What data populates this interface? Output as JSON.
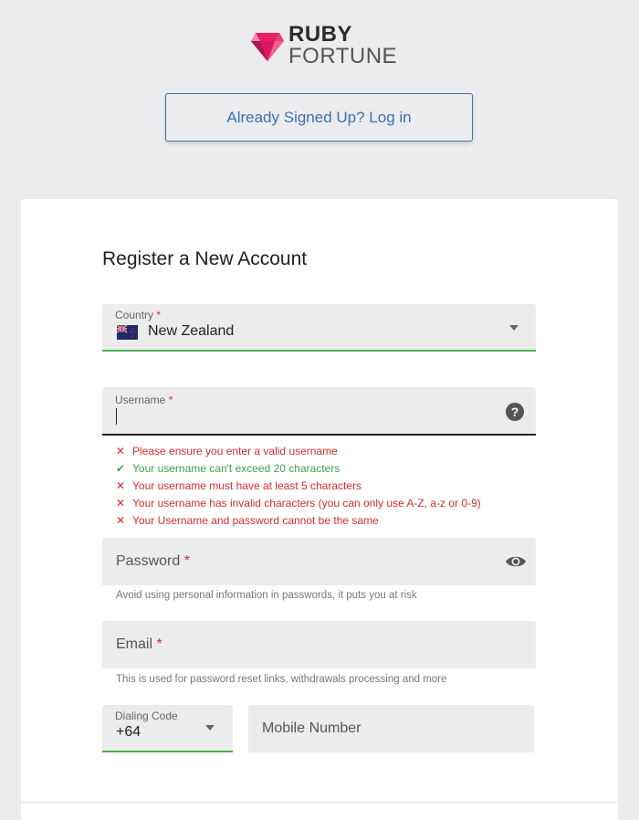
{
  "brand": {
    "name_line1": "RUBY",
    "name_line2": "FORTUNE",
    "logo_icon": "ruby-gem-icon",
    "accent_color": "#d81b4f"
  },
  "header": {
    "login_label": "Already Signed Up? Log in"
  },
  "form": {
    "title": "Register a New Account",
    "required_marker": "*",
    "country": {
      "label": "Country",
      "value": "New Zealand",
      "flag_icon": "new-zealand-flag-icon"
    },
    "username": {
      "label": "Username",
      "value": "",
      "help_icon": "question-mark-icon"
    },
    "validation": [
      {
        "status": "error",
        "text": "Please ensure you enter a valid username"
      },
      {
        "status": "ok",
        "text": "Your username can't exceed 20 characters"
      },
      {
        "status": "error",
        "text": "Your username must have at least 5 characters"
      },
      {
        "status": "error",
        "text": "Your username has invalid characters (you can only use A-Z, a-z or 0-9)"
      },
      {
        "status": "error",
        "text": "Your Username and password cannot be the same"
      }
    ],
    "password": {
      "placeholder": "Password",
      "hint": "Avoid using personal information in passwords, it puts you at risk",
      "toggle_icon": "eye-icon"
    },
    "email": {
      "placeholder": "Email",
      "hint": "This is used for password reset links, withdrawals processing and more"
    },
    "dialing_code": {
      "label": "Dialing Code",
      "value": "+64"
    },
    "mobile": {
      "placeholder": "Mobile Number"
    }
  },
  "colors": {
    "link_blue": "#3d6fb4",
    "error_red": "#d32f2f",
    "success_green": "#43a047",
    "field_bg": "#ececec"
  }
}
